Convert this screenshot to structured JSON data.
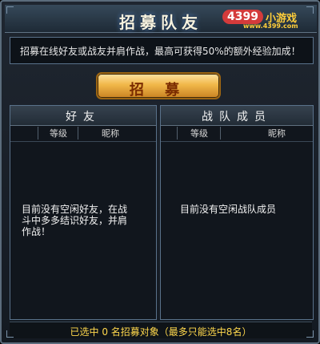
{
  "header": {
    "title": "招募队友",
    "logo_main": "4399",
    "logo_cn": "小游戏",
    "logo_url": "www.4399.com"
  },
  "intro": {
    "text": "招募在线好友或战友并肩作战，最高可获得50%的额外经验加成！"
  },
  "recruit_button": {
    "label": "招  募"
  },
  "friends": {
    "tab_title": "好友",
    "col_level": "等级",
    "col_nickname": "昵称",
    "empty_text": "目前没有空闲好友，在战斗中多多结识好友，并肩作战！"
  },
  "team": {
    "tab_title": "战队成员",
    "col_level": "等级",
    "col_nickname": "昵称",
    "empty_text": "目前没有空闲战队成员"
  },
  "footer": {
    "text": "已选中 0 名招募对象（最多只能选中8名）"
  }
}
